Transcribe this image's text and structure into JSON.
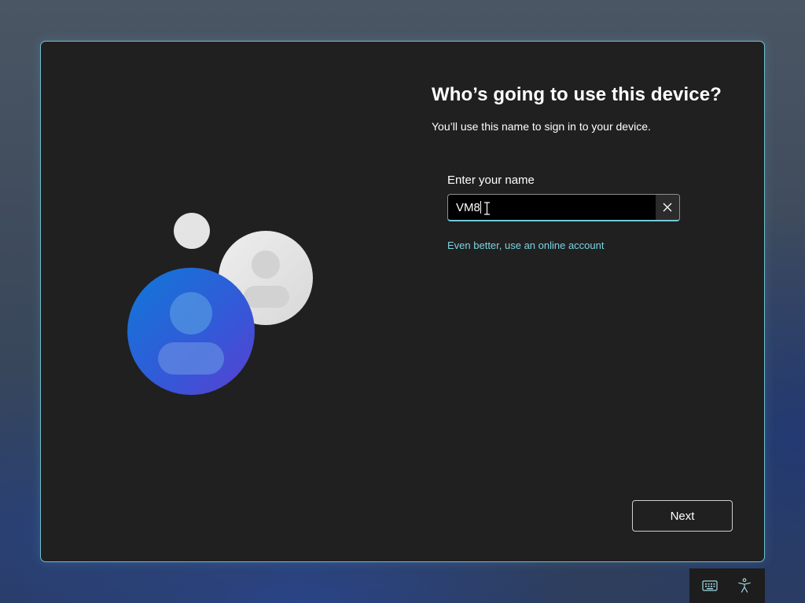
{
  "dialog": {
    "title": "Who’s going to use this device?",
    "subtitle": "You’ll use this name to sign in to your device.",
    "name_field": {
      "label": "Enter your name",
      "value": "VM8"
    },
    "online_account_link": "Even better, use an online account",
    "next_button": "Next"
  },
  "icons": {
    "clear": "close-icon",
    "keyboard": "keyboard-icon",
    "accessibility": "accessibility-icon",
    "illustration": "user-accounts-illustration"
  },
  "colors": {
    "accent": "#74c8d6",
    "link": "#7ad3e0",
    "dialog_background": "#202020",
    "avatar_blue": "#2f6fd6",
    "avatar_gray": "#e6e6e6"
  }
}
